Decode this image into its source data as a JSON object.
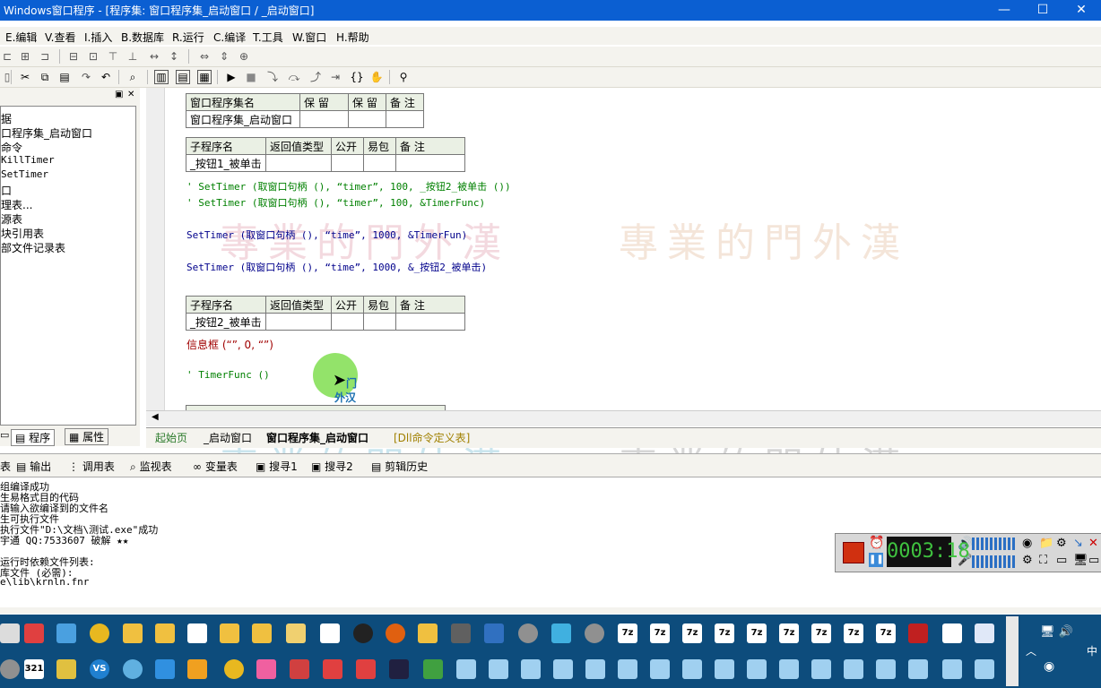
{
  "window": {
    "title": "Windows窗口程序 - [程序集: 窗口程序集_启动窗口 / _启动窗口]",
    "min_glyph": "—",
    "max_glyph": "☐",
    "close_glyph": "✕"
  },
  "menu": [
    "E.编辑",
    "V.查看",
    "I.插入",
    "B.数据库",
    "R.运行",
    "C.编译",
    "T.工具",
    "W.窗口",
    "H.帮助"
  ],
  "left_panel": {
    "close_glyph": "✕",
    "tree": [
      "据",
      "口程序集_启动窗口",
      "命令",
      "KillTimer",
      "SetTimer",
      "口",
      "理表...",
      "源表",
      "块引用表",
      "部文件记录表"
    ],
    "tabs": [
      "程序",
      "属性"
    ]
  },
  "program_set_table": {
    "headers": [
      "窗口程序集名",
      "保 留",
      "保 留",
      "备 注"
    ],
    "row": [
      "窗口程序集_启动窗口",
      "",
      "",
      ""
    ]
  },
  "sub1_table": {
    "headers": [
      "子程序名",
      "返回值类型",
      "公开",
      "易包",
      "备 注"
    ],
    "row": [
      "_按钮1_被单击",
      "",
      "",
      "",
      ""
    ]
  },
  "code_lines_1": {
    "l1": "' SetTimer (取窗口句柄 (), “timer”, 100, _按钮2_被单击 ())",
    "l2": "' SetTimer (取窗口句柄 (), “timer”, 100, &TimerFunc)",
    "l3": "SetTimer (取窗口句柄 (), “time”, 1000, &TimerFun)",
    "l4": "SetTimer (取窗口句柄 (), “time”, 1000, &_按钮2_被单击)"
  },
  "sub2_table": {
    "headers": [
      "子程序名",
      "返回值类型",
      "公开",
      "易包",
      "备 注"
    ],
    "row": [
      "_按钮2_被单击",
      "",
      "",
      "",
      ""
    ]
  },
  "code_lines_2": {
    "l1": "信息框 (“”, 0, “”)",
    "l2": "' TimerFunc ()"
  },
  "cursor_label": {
    "a": "门",
    "b": "外汉"
  },
  "doc_tabs": [
    "起始页",
    "_启动窗口",
    "窗口程序集_启动窗口",
    "[Dll命令定义表]"
  ],
  "bottom_tabs": [
    "表",
    "输出",
    "调用表",
    "监视表",
    "变量表",
    "搜寻1",
    "搜寻2",
    "剪辑历史"
  ],
  "output_lines": [
    "组编译成功",
    "生易格式目的代码",
    "请输入欲编译到的文件名",
    "生可执行文件",
    "执行文件\"D:\\文档\\测试.exe\"成功",
    "宇通 QQ:7533607 破解 ★★",
    "",
    "运行时依赖文件列表:",
    "库文件 (必需):",
    "e\\lib\\krnln.fnr"
  ],
  "recorder": {
    "time": "0003:18"
  },
  "watermark": "專業的門外漢",
  "taskbar_7z": "7z",
  "taskbar_321": "321",
  "taskbar_vs": "VS",
  "taskbar_cn": "中",
  "tray_glyphs": "🖥 🔊",
  "colors": {
    "titlebar": "#0b5fd2",
    "taskbar": "#0d4c7c",
    "table_header": "#eaf0e4",
    "comment": "#008000"
  }
}
